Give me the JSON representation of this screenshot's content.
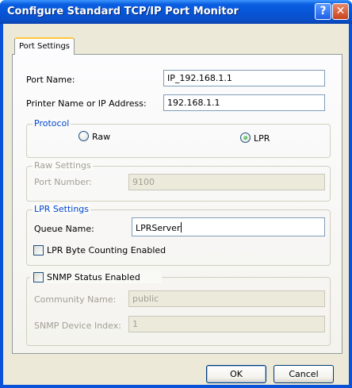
{
  "window": {
    "title": "Configure Standard TCP/IP Port Monitor",
    "help_glyph": "?",
    "close_glyph": "✕"
  },
  "tabs": [
    {
      "label": "Port Settings",
      "active": true
    }
  ],
  "port": {
    "name_label": "Port Name:",
    "name_value": "IP_192.168.1.1",
    "address_label": "Printer Name or IP Address:",
    "address_value": "192.168.1.1"
  },
  "protocol": {
    "legend": "Protocol",
    "options": [
      {
        "label": "Raw",
        "selected": false
      },
      {
        "label": "LPR",
        "selected": true
      }
    ]
  },
  "raw_settings": {
    "legend": "Raw Settings",
    "port_number_label": "Port Number:",
    "port_number_value": "9100",
    "enabled": false
  },
  "lpr_settings": {
    "legend": "LPR Settings",
    "queue_name_label": "Queue Name:",
    "queue_name_value": "LPRServer",
    "byte_counting_label": "LPR Byte Counting Enabled",
    "byte_counting_checked": false
  },
  "snmp": {
    "status_label": "SNMP Status Enabled",
    "status_checked": false,
    "community_label": "Community Name:",
    "community_value": "public",
    "device_index_label": "SNMP Device Index:",
    "device_index_value": "1",
    "enabled": false
  },
  "buttons": {
    "ok": "OK",
    "cancel": "Cancel"
  },
  "colors": {
    "titlebar": "#0654d6",
    "dialog_bg": "#ece9d8",
    "group_legend": "#0046d5",
    "disabled_text": "#a19f93"
  }
}
